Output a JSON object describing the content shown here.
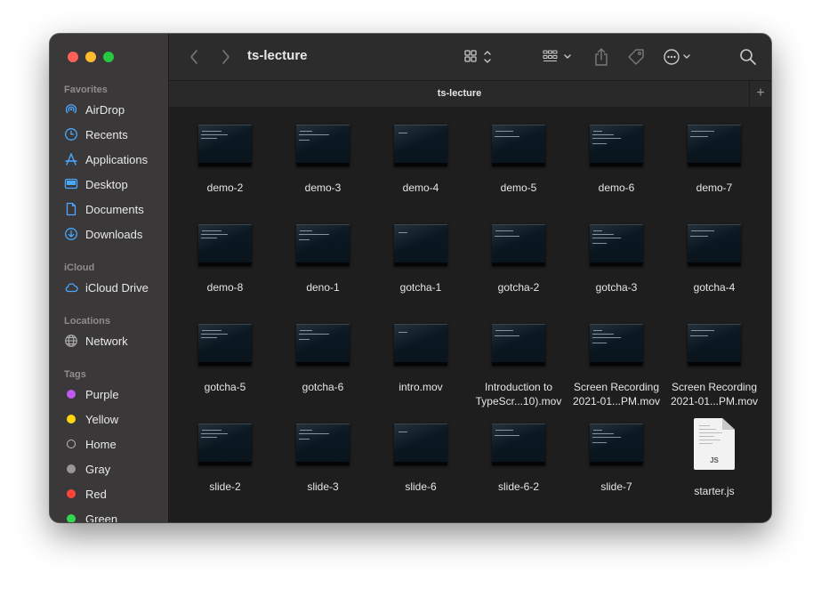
{
  "window": {
    "title": "ts-lecture"
  },
  "tab": {
    "label": "ts-lecture",
    "add_label": "+"
  },
  "sidebar": {
    "favorites_title": "Favorites",
    "favorites": [
      {
        "label": "AirDrop",
        "icon": "airdrop-icon"
      },
      {
        "label": "Recents",
        "icon": "clock-icon"
      },
      {
        "label": "Applications",
        "icon": "applications-icon"
      },
      {
        "label": "Desktop",
        "icon": "desktop-icon"
      },
      {
        "label": "Documents",
        "icon": "document-icon"
      },
      {
        "label": "Downloads",
        "icon": "download-icon"
      }
    ],
    "icloud_title": "iCloud",
    "icloud": [
      {
        "label": "iCloud Drive",
        "icon": "cloud-icon"
      }
    ],
    "locations_title": "Locations",
    "locations": [
      {
        "label": "Network",
        "icon": "globe-icon"
      }
    ],
    "tags_title": "Tags",
    "tags": [
      {
        "label": "Purple",
        "color": "#bf5af2"
      },
      {
        "label": "Yellow",
        "color": "#ffd60a"
      },
      {
        "label": "Home",
        "color": "hollow"
      },
      {
        "label": "Gray",
        "color": "#98989d"
      },
      {
        "label": "Red",
        "color": "#ff453a"
      },
      {
        "label": "Green",
        "color": "#32d74b"
      }
    ]
  },
  "files": [
    {
      "name": "demo-2",
      "type": "video"
    },
    {
      "name": "demo-3",
      "type": "video"
    },
    {
      "name": "demo-4",
      "type": "video"
    },
    {
      "name": "demo-5",
      "type": "video"
    },
    {
      "name": "demo-6",
      "type": "video"
    },
    {
      "name": "demo-7",
      "type": "video"
    },
    {
      "name": "demo-8",
      "type": "video"
    },
    {
      "name": "deno-1",
      "type": "video"
    },
    {
      "name": "gotcha-1",
      "type": "video"
    },
    {
      "name": "gotcha-2",
      "type": "video"
    },
    {
      "name": "gotcha-3",
      "type": "video"
    },
    {
      "name": "gotcha-4",
      "type": "video"
    },
    {
      "name": "gotcha-5",
      "type": "video"
    },
    {
      "name": "gotcha-6",
      "type": "video"
    },
    {
      "name": "intro.mov",
      "type": "video"
    },
    {
      "name": "Introduction to\nTypeScr...10).mov",
      "type": "video"
    },
    {
      "name": "Screen Recording\n2021-01...PM.mov",
      "type": "video"
    },
    {
      "name": "Screen Recording\n2021-01...PM.mov",
      "type": "video"
    },
    {
      "name": "slide-2",
      "type": "video"
    },
    {
      "name": "slide-3",
      "type": "video"
    },
    {
      "name": "slide-6",
      "type": "video"
    },
    {
      "name": "slide-6-2",
      "type": "video"
    },
    {
      "name": "slide-7",
      "type": "video"
    },
    {
      "name": "starter.js",
      "type": "js",
      "badge": "JS"
    }
  ]
}
